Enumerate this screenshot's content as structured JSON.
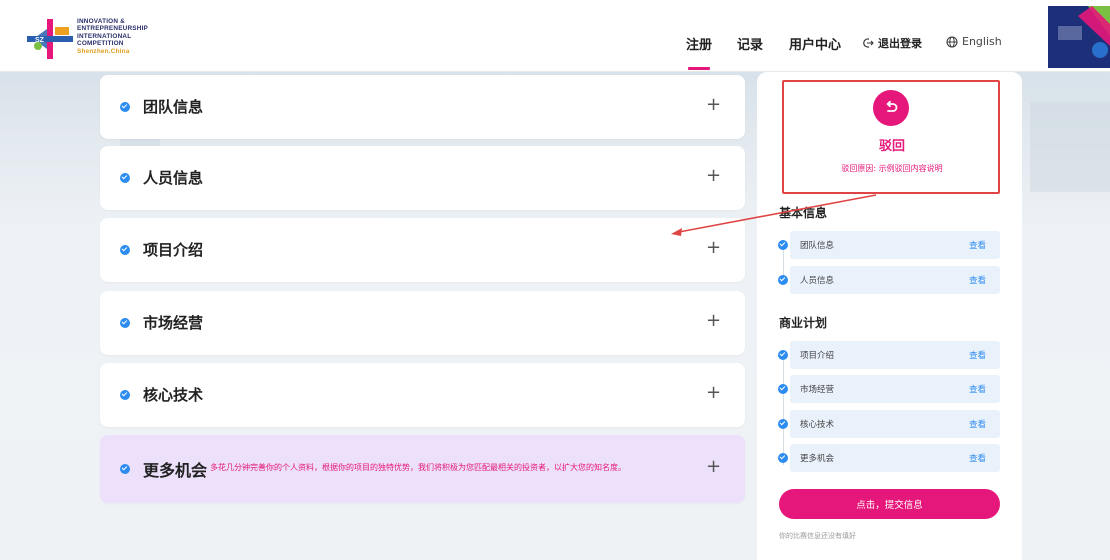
{
  "header": {
    "logo_lines": [
      "INNOVATION &",
      "ENTREPRENEURSHIP",
      "INTERNATIONAL",
      "COMPETITION"
    ],
    "logo_sub": "Shenzhen.China",
    "nav": {
      "register": "注册",
      "records": "记录",
      "user_center": "用户中心",
      "logout": "退出登录",
      "language": "English"
    }
  },
  "sections": [
    {
      "title": "团队信息",
      "expand": "+"
    },
    {
      "title": "人员信息",
      "expand": "+"
    },
    {
      "title": "项目介绍",
      "expand": "+"
    },
    {
      "title": "市场经营",
      "expand": "+"
    },
    {
      "title": "核心技术",
      "expand": "+"
    },
    {
      "title": "更多机会",
      "expand": "+",
      "description": "多花几分钟完善你的个人资料，根据你的项目的独特优势，我们将积极为您匹配最相关的投资者，以扩大您的知名度。"
    }
  ],
  "panel": {
    "status": "驳回",
    "reason": "驳回原因: 示例驳回内容说明",
    "basic_info": {
      "title": "基本信息",
      "items": [
        {
          "label": "团队信息",
          "action": "查看"
        },
        {
          "label": "人员信息",
          "action": "查看"
        }
      ]
    },
    "business_plan": {
      "title": "商业计划",
      "items": [
        {
          "label": "项目介绍",
          "action": "查看"
        },
        {
          "label": "市场经营",
          "action": "查看"
        },
        {
          "label": "核心技术",
          "action": "查看"
        },
        {
          "label": "更多机会",
          "action": "查看"
        }
      ]
    },
    "submit_label": "点击，提交信息",
    "hint": "你的比赛信息还没有填好"
  },
  "colors": {
    "brand": "#e6177a",
    "check": "#2d8cf0",
    "annotation": "#e04545",
    "more_bg": "#ece0fa"
  }
}
